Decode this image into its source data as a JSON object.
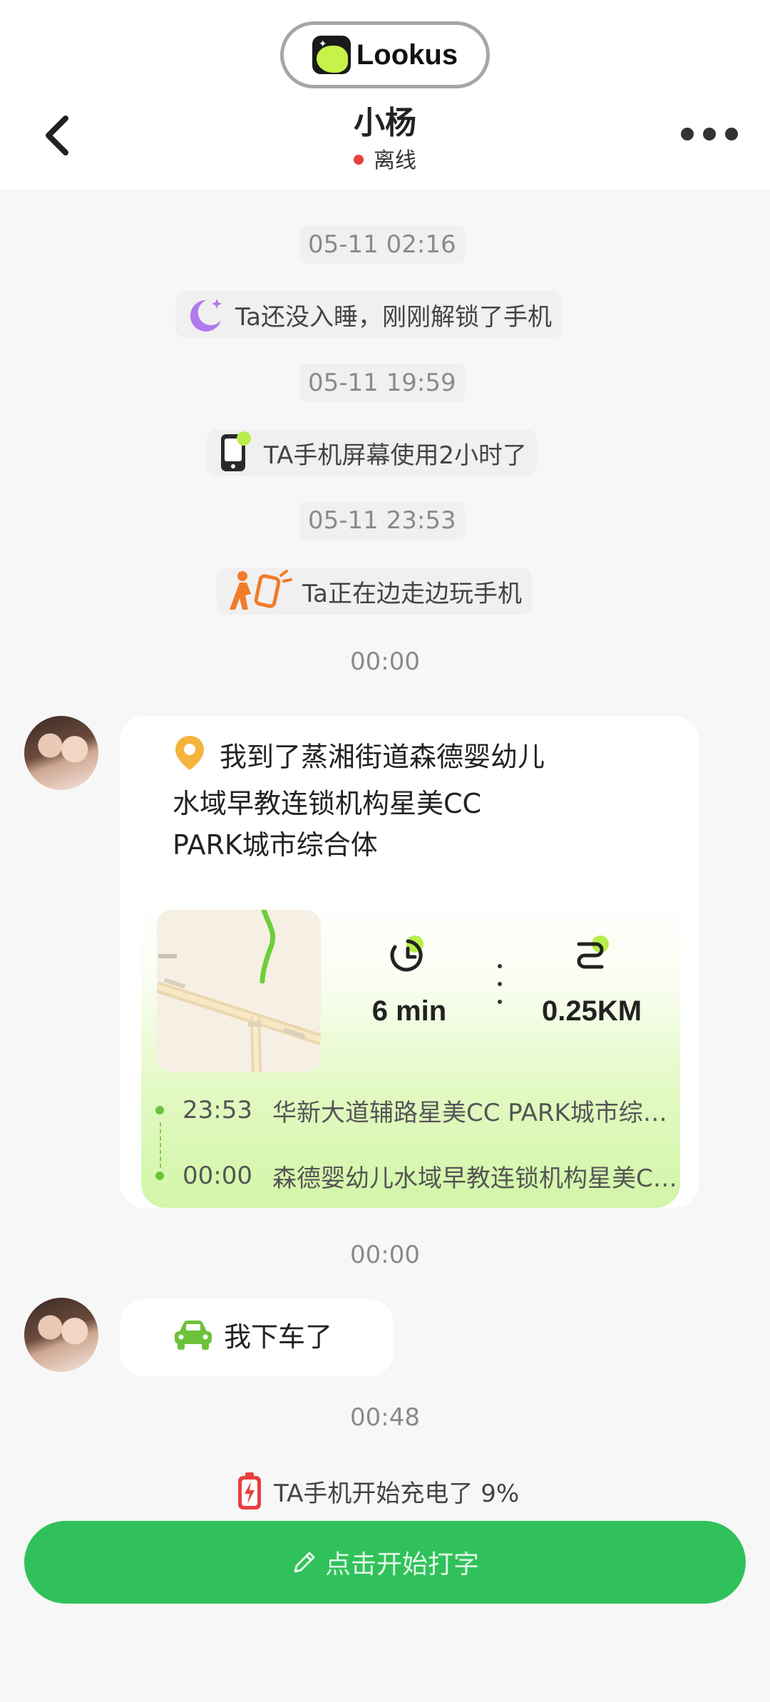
{
  "brand": {
    "name": "Lookus"
  },
  "header": {
    "title": "小杨",
    "status": "离线",
    "status_color": "#e84040"
  },
  "timeline": [
    {
      "time": "05-11 02:16",
      "event": "Ta还没入睡，刚刚解锁了手机",
      "icon": "moon-icon"
    },
    {
      "time": "05-11 19:59",
      "event": "TA手机屏幕使用2小时了",
      "icon": "phone-screen-icon"
    },
    {
      "time": "05-11 23:53",
      "event": "Ta正在边走边玩手机",
      "icon": "walking-phone-icon"
    }
  ],
  "location_message": {
    "time": "00:00",
    "text_line1": "我到了蒸湘街道森德婴幼儿",
    "text_line2": "水域早教连锁机构星美CC",
    "text_line3": "PARK城市综合体",
    "duration": "6 min",
    "distance": "0.25KM",
    "route": [
      {
        "time": "23:53",
        "place": "华新大道辅路星美CC PARK城市综合体"
      },
      {
        "time": "00:00",
        "place": "森德婴幼儿水域早教连锁机构星美CC PARK城市综合体"
      }
    ]
  },
  "car_message": {
    "time": "00:00",
    "text": "我下车了"
  },
  "charging_event": {
    "time": "00:48",
    "text": "TA手机开始充电了 9%",
    "icon": "battery-charging-icon"
  },
  "composer": {
    "label": "点击开始打字"
  },
  "colors": {
    "accent": "#31c15b",
    "lime": "#c6f24a",
    "route_green": "#6cc23a"
  }
}
